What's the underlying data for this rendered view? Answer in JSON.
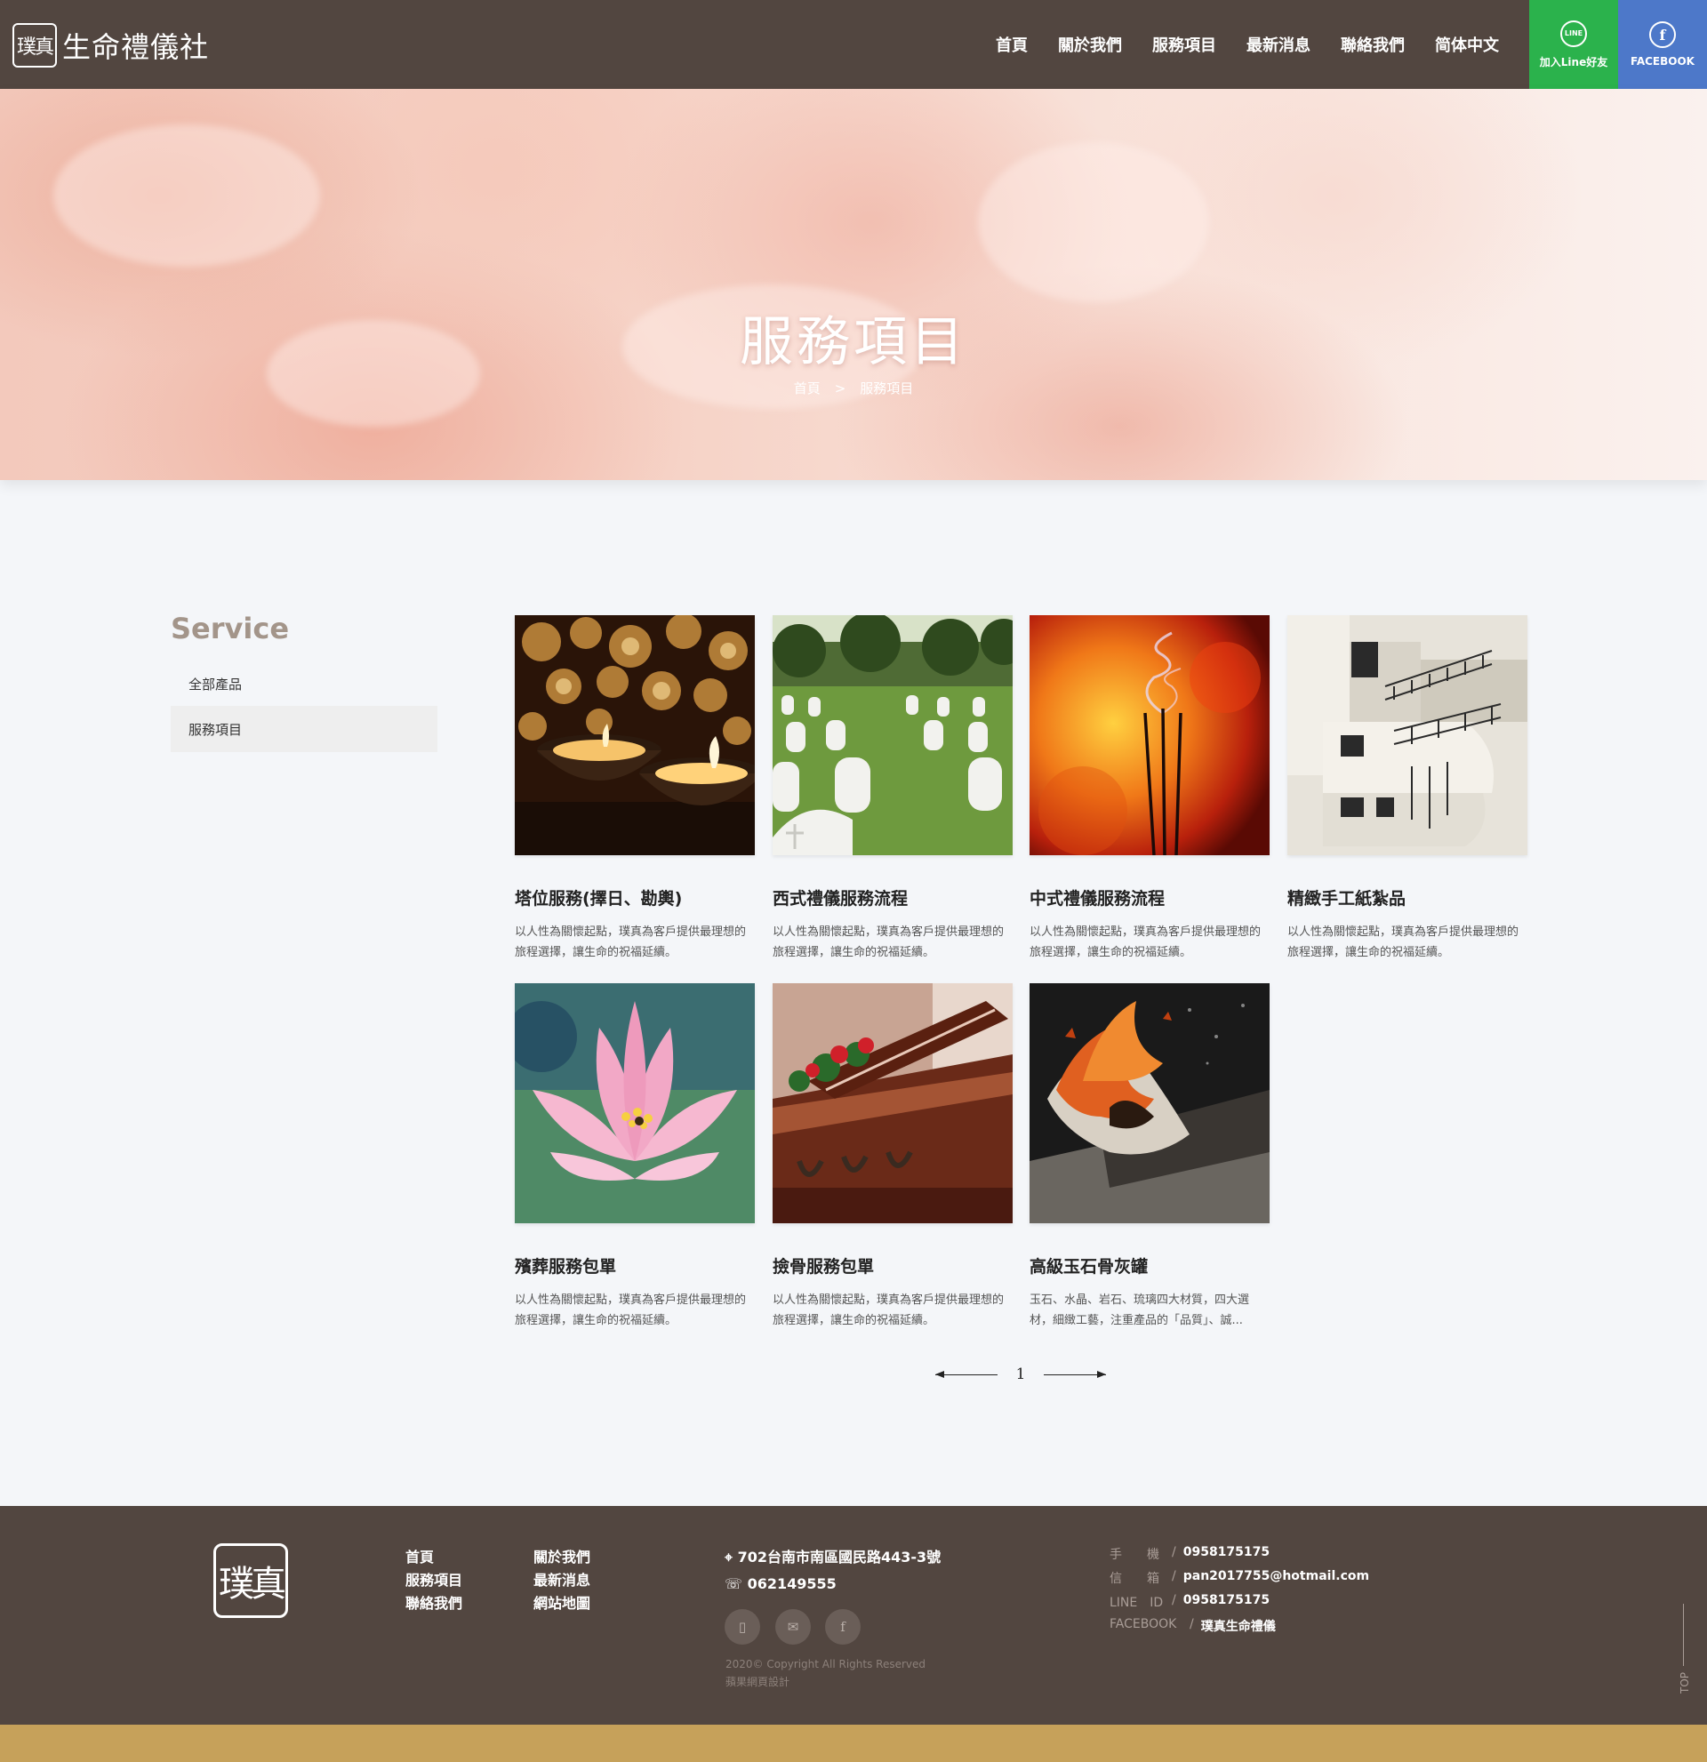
{
  "header": {
    "logo_mark": "璞真",
    "logo_text": "生命禮儀社",
    "nav": [
      "首頁",
      "關於我們",
      "服務項目",
      "最新消息",
      "聯絡我們",
      "简体中文"
    ],
    "line_icon": "LINE",
    "line_label": "加入Line好友",
    "fb_icon": "f",
    "fb_label": "FACEBOOK",
    "colors": {
      "header_bg": "#524640",
      "line_bg": "#2bb24c",
      "fb_bg": "#4d78c9"
    }
  },
  "hero": {
    "title": "服務項目",
    "breadcrumb": [
      "首頁",
      ">",
      "服務項目"
    ]
  },
  "sidebar": {
    "title": "Service",
    "items": [
      {
        "label": "全部產品",
        "active": false
      },
      {
        "label": "服務項目",
        "active": true
      }
    ]
  },
  "services": [
    {
      "title": "塔位服務(擇日、勘輿)",
      "desc": "以人性為關懷起點，璞真為客戶提供最理想的旅程選擇，讓生命的祝福延續。",
      "image": "candles"
    },
    {
      "title": "西式禮儀服務流程",
      "desc": "以人性為關懷起點，璞真為客戶提供最理想的旅程選擇，讓生命的祝福延續。",
      "image": "cemetery"
    },
    {
      "title": "中式禮儀服務流程",
      "desc": "以人性為關懷起點，璞真為客戶提供最理想的旅程選擇，讓生命的祝福延續。",
      "image": "incense"
    },
    {
      "title": "精緻手工紙紮品",
      "desc": "以人性為關懷起點，璞真為客戶提供最理想的旅程選擇，讓生命的祝福延續。",
      "image": "paper-house"
    },
    {
      "title": "殯葬服務包單",
      "desc": "以人性為關懷起點，璞真為客戶提供最理想的旅程選擇，讓生命的祝福延續。",
      "image": "lotus"
    },
    {
      "title": "撿骨服務包單",
      "desc": "以人性為關懷起點，璞真為客戶提供最理想的旅程選擇，讓生命的祝福延續。",
      "image": "coffin"
    },
    {
      "title": "高級玉石骨灰罐",
      "desc": "玉石、水晶、岩石、琉璃四大材質，四大選材，細緻工藝，注重產品的「品質」、誠...",
      "image": "burning-paper"
    }
  ],
  "pagination": {
    "current": "1"
  },
  "footer": {
    "logo_mark": "璞真",
    "links": [
      "首頁",
      "關於我們",
      "服務項目",
      "最新消息",
      "聯絡我們",
      "網站地圖"
    ],
    "address": "702台南市南區國民路443-3號",
    "phone": "062149555",
    "social_icons": [
      "mobile-icon",
      "mail-icon",
      "facebook-icon"
    ],
    "copyright": "2020© Copyright All Rights Reserved",
    "designer": "蘋果網頁設計",
    "contacts": [
      {
        "key": "手　　機",
        "val": "0958175175"
      },
      {
        "key": "信　　箱",
        "val": "pan2017755@hotmail.com"
      },
      {
        "key": "LINE　ID",
        "val": "0958175175"
      },
      {
        "key": "FACEBOOK",
        "val": "璞真生命禮儀"
      }
    ],
    "top_label": "TOP",
    "colors": {
      "footer_bg": "#524640",
      "bottom_bar": "#c6a15a"
    }
  }
}
